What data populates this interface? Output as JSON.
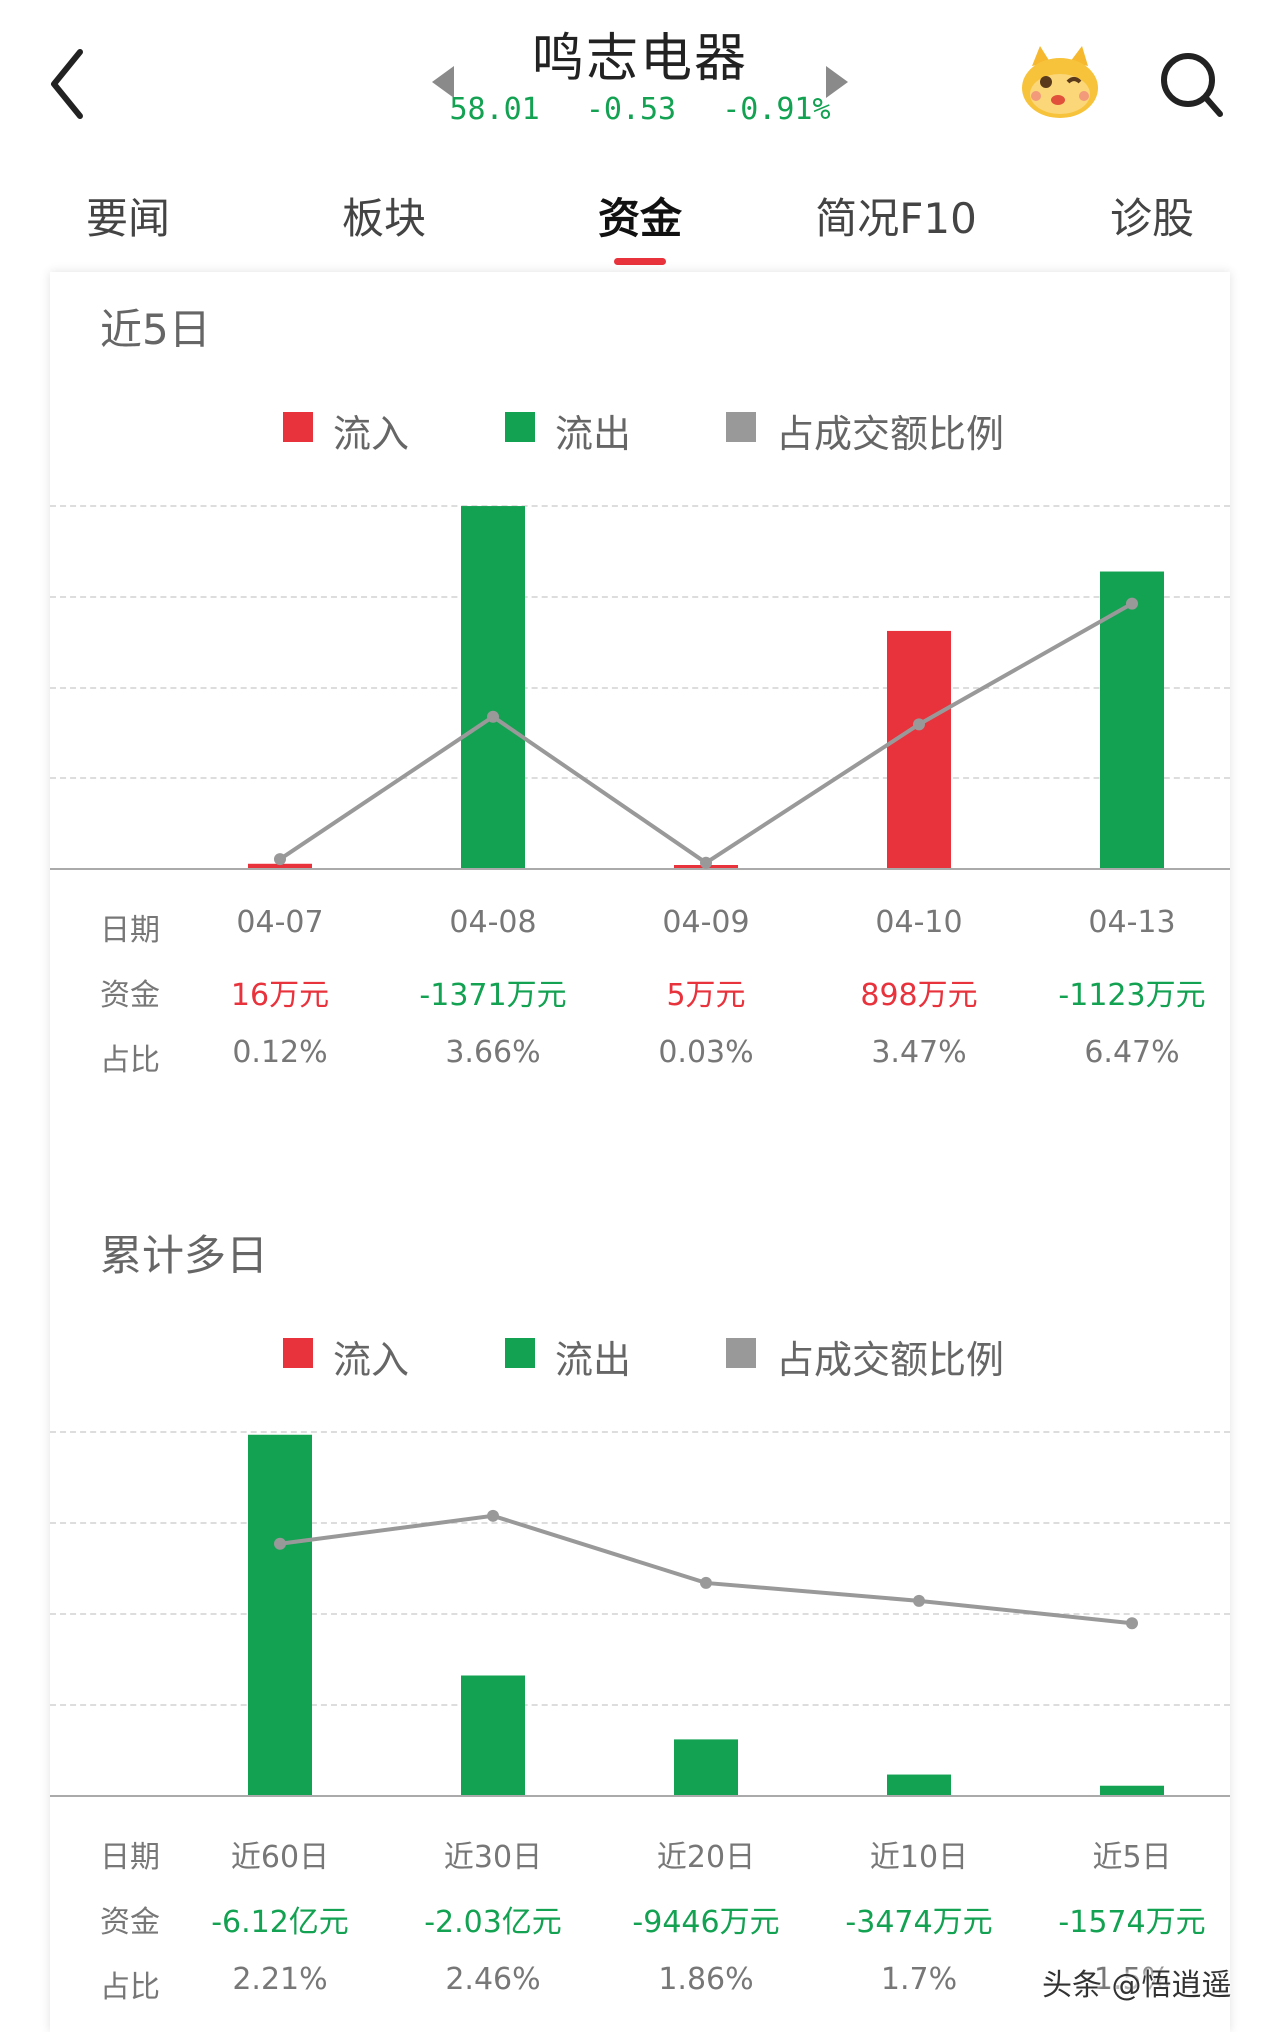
{
  "header": {
    "title": "鸣志电器",
    "price": "58.01",
    "change": "-0.53",
    "change_pct": "-0.91%"
  },
  "tabs": [
    {
      "label": "要闻"
    },
    {
      "label": "板块"
    },
    {
      "label": "资金"
    },
    {
      "label": "简况F10"
    },
    {
      "label": "诊股"
    }
  ],
  "active_tab": "资金",
  "colors": {
    "inflow": "#e8323c",
    "outflow": "#13a152",
    "ratio_line": "#999999",
    "price_down": "#13a152"
  },
  "legend": {
    "inflow": "流入",
    "outflow": "流出",
    "ratio": "占成交额比例"
  },
  "row_labels": {
    "date": "日期",
    "amount": "资金",
    "ratio": "占比"
  },
  "sections": [
    {
      "title": "近5日",
      "columns": [
        {
          "date": "04-07",
          "amount": "16万元",
          "ratio": "0.12%"
        },
        {
          "date": "04-08",
          "amount": "-1371万元",
          "ratio": "3.66%"
        },
        {
          "date": "04-09",
          "amount": "5万元",
          "ratio": "0.03%"
        },
        {
          "date": "04-10",
          "amount": "898万元",
          "ratio": "3.47%"
        },
        {
          "date": "04-13",
          "amount": "-1123万元",
          "ratio": "6.47%"
        }
      ]
    },
    {
      "title": "累计多日",
      "columns": [
        {
          "date": "近60日",
          "amount": "-6.12亿元",
          "ratio": "2.21%"
        },
        {
          "date": "近30日",
          "amount": "-2.03亿元",
          "ratio": "2.46%"
        },
        {
          "date": "近20日",
          "amount": "-9446万元",
          "ratio": "1.86%"
        },
        {
          "date": "近10日",
          "amount": "-3474万元",
          "ratio": "1.7%"
        },
        {
          "date": "近5日",
          "amount": "-1574万元",
          "ratio": "1.5%"
        }
      ]
    }
  ],
  "chart_data": [
    {
      "type": "bar",
      "title": "近5日",
      "categories": [
        "04-07",
        "04-08",
        "04-09",
        "04-10",
        "04-13"
      ],
      "series": [
        {
          "name": "流入",
          "values": [
            16,
            null,
            5,
            898,
            null
          ]
        },
        {
          "name": "流出",
          "values": [
            null,
            1371,
            null,
            null,
            1123
          ]
        },
        {
          "name": "占成交额比例",
          "type": "line",
          "values": [
            0.12,
            3.66,
            0.03,
            3.47,
            6.47
          ]
        }
      ],
      "ylim": [
        0,
        1650
      ],
      "ratio_ylim": [
        0,
        8.2
      ],
      "grid": true,
      "legend_position": "top-center"
    },
    {
      "type": "bar",
      "title": "累计多日",
      "categories": [
        "近60日",
        "近30日",
        "近20日",
        "近10日",
        "近5日"
      ],
      "series": [
        {
          "name": "流入",
          "values": [
            null,
            null,
            null,
            null,
            null
          ]
        },
        {
          "name": "流出",
          "values": [
            61200,
            20300,
            9446,
            3474,
            1574
          ]
        },
        {
          "name": "占成交额比例",
          "type": "line",
          "values": [
            2.21,
            2.46,
            1.86,
            1.7,
            1.5
          ]
        }
      ],
      "ylim": [
        0,
        74000
      ],
      "ratio_ylim": [
        0,
        2.95
      ],
      "grid": true,
      "legend_position": "top-center"
    }
  ],
  "watermark": "头条 @悟逍遥"
}
